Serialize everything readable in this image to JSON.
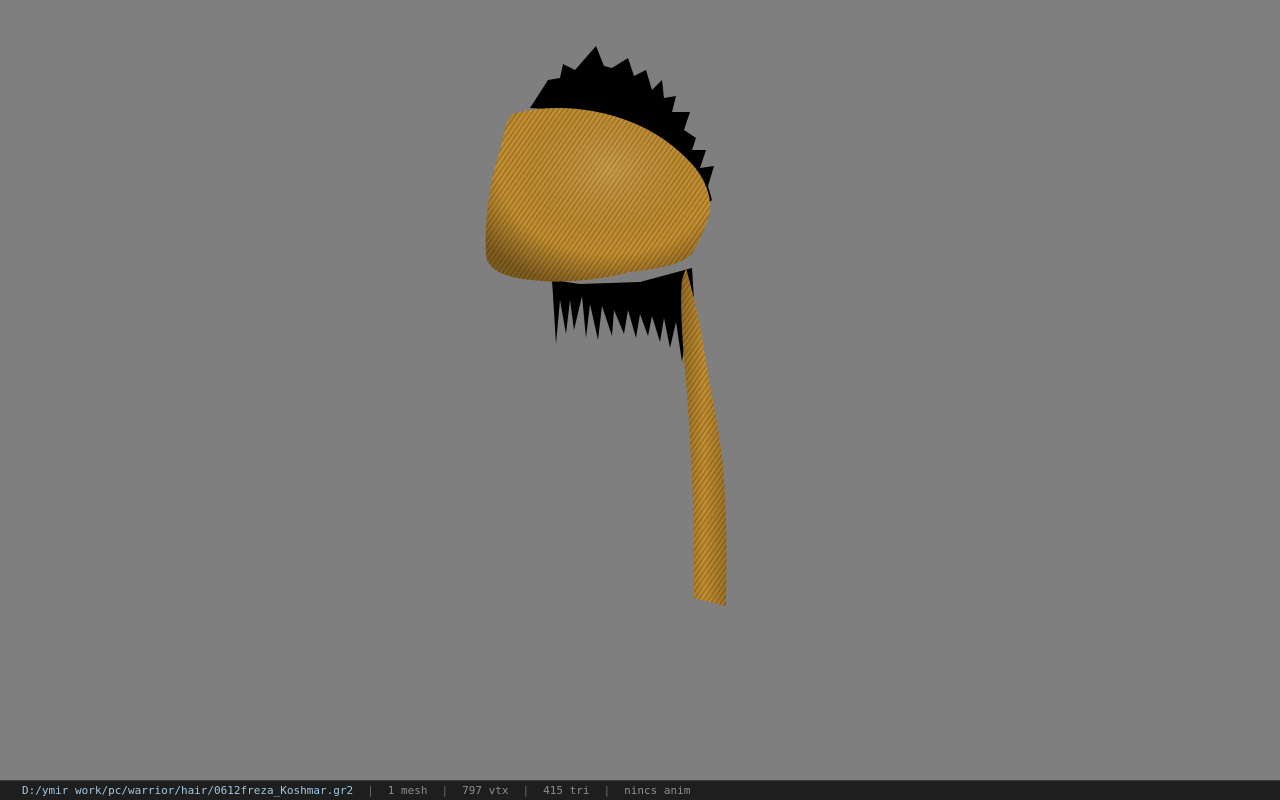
{
  "viewer": {
    "background_color": "#7f7f7f",
    "model": {
      "description_icon": "hair-mesh-model",
      "cloth_color": "#b8862b",
      "hair_color": "#000000"
    }
  },
  "statusbar": {
    "file_path": "D:/ymir work/pc/warrior/hair/0612freza_Koshmar.gr2",
    "sep": "|",
    "mesh_count": "1 mesh",
    "vertex_count": "797 vtx",
    "triangle_count": "415 tri",
    "anim_status": "nincs anim",
    "path_color": "#9cc4de",
    "text_color": "#8c8c8c"
  }
}
